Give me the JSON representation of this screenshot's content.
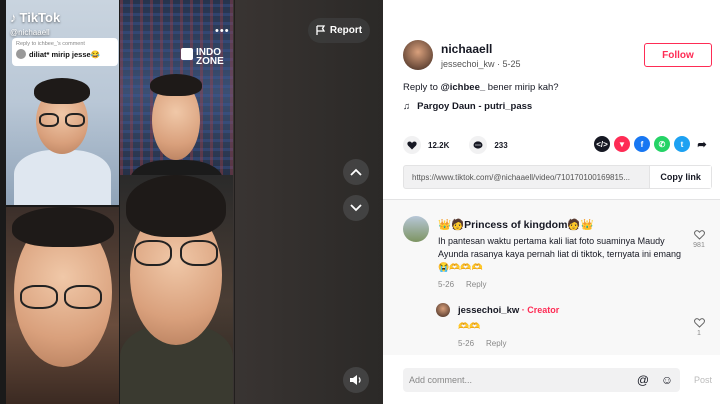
{
  "video": {
    "brand": "TikTok",
    "username": "@nichaaell",
    "reply_bubble": {
      "header": "Reply to ichbee_'s comment",
      "text": "diliat* mirip jesse😂"
    },
    "watermark": "INDO ZONE",
    "report_label": "Report"
  },
  "author": {
    "username": "nichaaell",
    "subline": "jessechoi_kw · 5-25",
    "follow_label": "Follow"
  },
  "caption": {
    "prefix": "Reply to ",
    "mention": "@ichbee_",
    "text": " bener mirip kah?"
  },
  "music": "Pargoy Daun - putri_pass",
  "stats": {
    "likes": "12.2K",
    "comments": "233"
  },
  "link": {
    "url": "https://www.tiktok.com/@nichaaell/video/710170100169815...",
    "copy_label": "Copy link"
  },
  "comments": [
    {
      "name": "👑🧑Princess of kingdom🧑👑",
      "text": "Ih pantesan waktu pertama kali liat foto suaminya Maudy Ayunda rasanya kaya pernah liat di tiktok, ternyata ini emang 😭🫶🫶🫶",
      "date": "5-26",
      "reply_label": "Reply",
      "likes": "981"
    },
    {
      "name": "jessechoi_kw",
      "badge": " · Creator",
      "text": "🫶🫶",
      "date": "5-26",
      "reply_label": "Reply",
      "likes": "1"
    }
  ],
  "composer": {
    "placeholder": "Add comment...",
    "post_label": "Post"
  },
  "colors": {
    "accent": "#fe2c55",
    "share_embed": "#161823",
    "share_tiktok": "#fe2c55",
    "share_facebook": "#1877f2",
    "share_whatsapp": "#25d366",
    "share_twitter": "#1da1f2"
  }
}
